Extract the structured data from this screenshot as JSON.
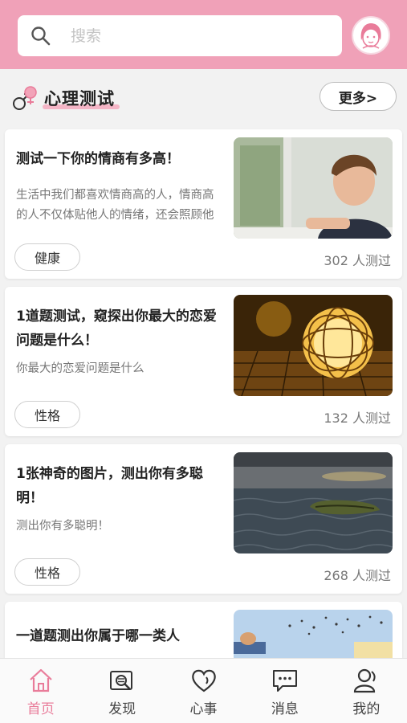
{
  "search": {
    "placeholder": "搜索"
  },
  "section": {
    "title": "心理测试",
    "more_label": "更多>"
  },
  "cards": [
    {
      "title": "测试一下你的情商有多高！",
      "desc": "生活中我们都喜欢情商高的人，情商高的人不仅体贴他人的情绪，还会照顾他人的感受",
      "tag": "健康",
      "count": "302 人测过",
      "image": "boy-at-window"
    },
    {
      "title": "1道题测试，窥探出你最大的恋爱问题是什么！",
      "desc": "你最大的恋爱问题是什么",
      "tag": "性格",
      "count": "132 人测过",
      "image": "glowing-ball-lamp"
    },
    {
      "title": "1张神奇的图片，测出你有多聪明！",
      "desc": "测出你有多聪明！",
      "tag": "性格",
      "count": "268 人测过",
      "image": "boat-on-sea"
    },
    {
      "title": "一道题测出你属于哪一类人",
      "desc": "",
      "tag": "",
      "count": "",
      "image": "person-with-birds"
    }
  ],
  "tabs": [
    {
      "label": "首页",
      "icon": "home-icon",
      "active": true
    },
    {
      "label": "发现",
      "icon": "discover-icon",
      "active": false
    },
    {
      "label": "心事",
      "icon": "heart-icon",
      "active": false
    },
    {
      "label": "消息",
      "icon": "message-icon",
      "active": false
    },
    {
      "label": "我的",
      "icon": "profile-icon",
      "active": false
    }
  ],
  "colors": {
    "header": "#f0a1b8",
    "accent": "#e97c9a",
    "underline": "#f4b5c6"
  }
}
